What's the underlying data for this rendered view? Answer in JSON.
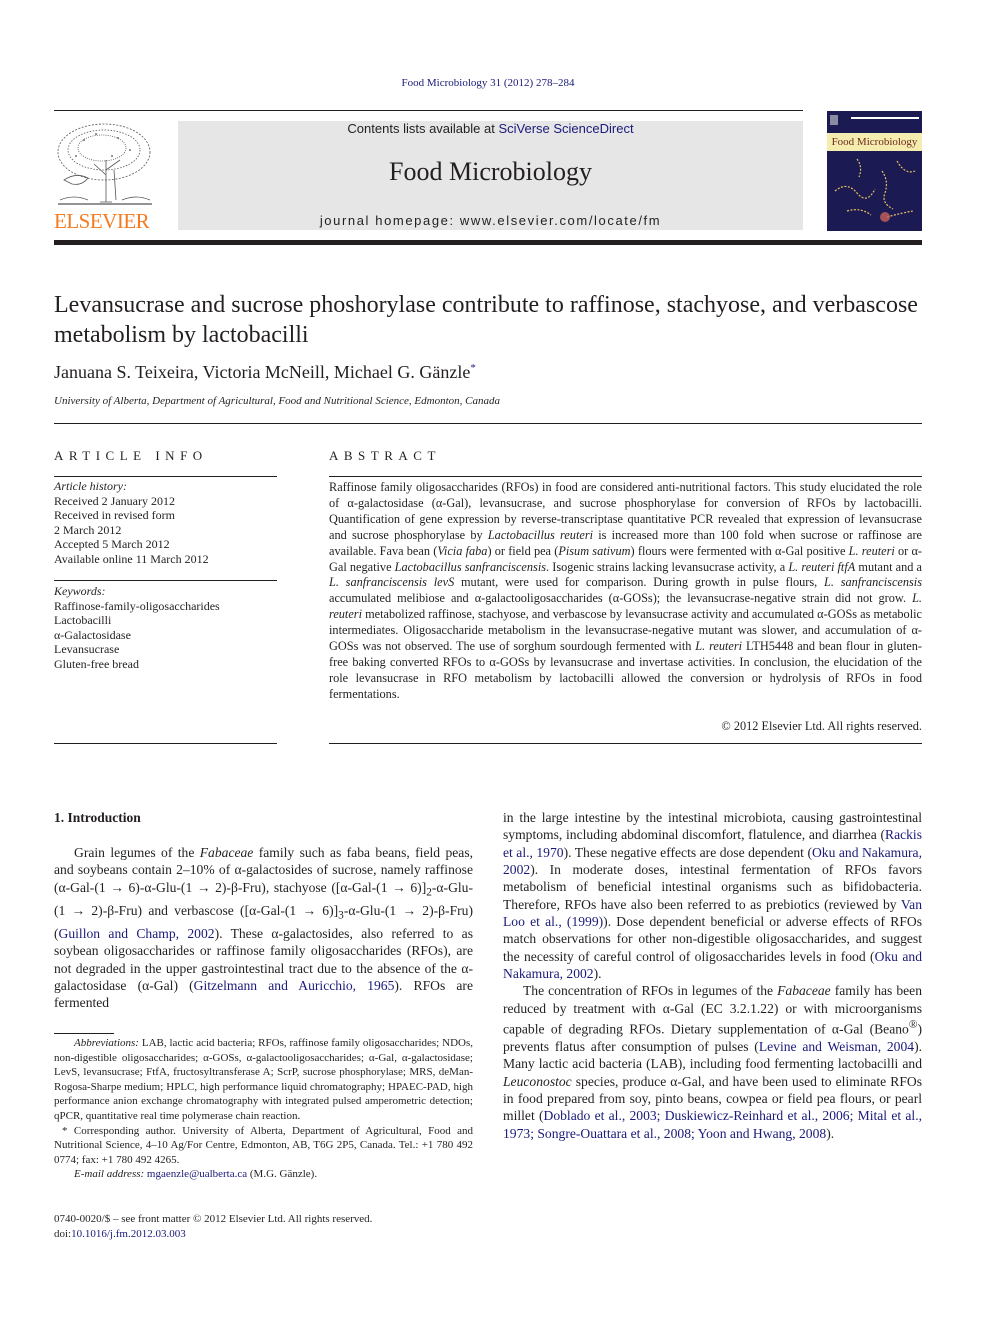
{
  "header": {
    "citation": "Food Microbiology 31 (2012) 278–284",
    "contents_prefix": "Contents lists available at ",
    "contents_link": "SciVerse ScienceDirect",
    "journal_name": "Food Microbiology",
    "homepage": "journal homepage: www.elsevier.com/locate/fm",
    "publisher_logo_text": "ELSEVIER",
    "cover_title": "Food Microbiology",
    "colors": {
      "publisher_orange": "#f47b20",
      "link_blue": "#1a1a7a",
      "box_gray": "#e6e6e6",
      "cover_navy": "#1b1a52"
    }
  },
  "article": {
    "title": "Levansucrase and sucrose phoshorylase contribute to raffinose, stachyose, and verbascose metabolism by lactobacilli",
    "authors": "Januana S. Teixeira, Victoria McNeill, Michael G. Gänzle",
    "author_mark": "*",
    "affiliation": "University of Alberta, Department of Agricultural, Food and Nutritional Science, Edmonton, Canada"
  },
  "article_info": {
    "heading": "ARTICLE INFO",
    "history_label": "Article history:",
    "history": [
      "Received 2 January 2012",
      "Received in revised form",
      "2 March 2012",
      "Accepted 5 March 2012",
      "Available online 11 March 2012"
    ],
    "keywords_label": "Keywords:",
    "keywords": [
      "Raffinose-family-oligosaccharides",
      "Lactobacilli",
      "α-Galactosidase",
      "Levansucrase",
      "Gluten-free bread"
    ]
  },
  "abstract": {
    "heading": "ABSTRACT",
    "segments": [
      {
        "t": "Raffinose family oligosaccharides (RFOs) in food are considered anti-nutritional factors. This study elucidated the role of α-galactosidase (α-Gal), levansucrase, and sucrose phosphorylase for conversion of RFOs by lactobacilli. Quantification of gene expression by reverse-transcriptase quantitative PCR revealed that expression of levansucrase and sucrose phosphorylase by "
      },
      {
        "t": "Lactobacillus reuteri",
        "i": true
      },
      {
        "t": " is increased more than 100 fold when sucrose or raffinose are available. Fava bean ("
      },
      {
        "t": "Vicia faba",
        "i": true
      },
      {
        "t": ") or field pea ("
      },
      {
        "t": "Pisum sativum",
        "i": true
      },
      {
        "t": ") flours were fermented with α-Gal positive "
      },
      {
        "t": "L. reuteri",
        "i": true
      },
      {
        "t": " or α-Gal negative "
      },
      {
        "t": "Lactobacillus sanfranciscensis",
        "i": true
      },
      {
        "t": ". Isogenic strains lacking levansucrase activity, a "
      },
      {
        "t": "L. reuteri ftfA",
        "i": true
      },
      {
        "t": " mutant and a "
      },
      {
        "t": "L. sanfranciscensis levS",
        "i": true
      },
      {
        "t": " mutant, were used for comparison. During growth in pulse flours, "
      },
      {
        "t": "L. sanfranciscensis",
        "i": true
      },
      {
        "t": " accumulated melibiose and α-galactooligosaccharides (α-GOSs); the levansucrase-negative strain did not grow. "
      },
      {
        "t": "L. reuteri",
        "i": true
      },
      {
        "t": " metabolized raffinose, stachyose, and verbascose by levansucrase activity and accumulated α-GOSs as metabolic intermediates. Oligosaccharide metabolism in the levansucrase-negative mutant was slower, and accumulation of α-GOSs was not observed. The use of sorghum sourdough fermented with "
      },
      {
        "t": "L. reuteri",
        "i": true
      },
      {
        "t": " LTH5448 and bean flour in gluten-free baking converted RFOs to α-GOSs by levansucrase and invertase activities. In conclusion, the elucidation of the role levansucrase in RFO metabolism by lactobacilli allowed the conversion or hydrolysis of RFOs in food fermentations."
      }
    ],
    "copyright": "© 2012 Elsevier Ltd. All rights reserved."
  },
  "intro": {
    "heading": "1.  Introduction",
    "left_paragraph": [
      {
        "t": "Grain legumes of the "
      },
      {
        "t": "Fabaceae",
        "i": true
      },
      {
        "t": " family such as faba beans, field peas, and soybeans contain 2–10% of α-galactosides of sucrose, namely raffinose (α-Gal-(1 → 6)-α-Glu-(1 → 2)-β-Fru), stachyose ([α-Gal-(1 → 6)]"
      },
      {
        "t": "2",
        "sub": true
      },
      {
        "t": "-α-Glu-(1 → 2)-β-Fru) and verbascose ([α-Gal-(1 → 6)]"
      },
      {
        "t": "3",
        "sub": true
      },
      {
        "t": "-α-Glu-(1 → 2)-β-Fru) ("
      },
      {
        "t": "Guillon and Champ, 2002",
        "link": true
      },
      {
        "t": "). These α-galactosides, also referred to as soybean oligosaccharides or raffinose family oligosaccharides (RFOs), are not degraded in the upper gastrointestinal tract due to the absence of the α-galactosidase (α-Gal) ("
      },
      {
        "t": "Gitzelmann and Auricchio, 1965",
        "link": true
      },
      {
        "t": "). RFOs are fermented"
      }
    ],
    "right_paragraph_1": [
      {
        "t": "in the large intestine by the intestinal microbiota, causing gastrointestinal symptoms, including abdominal discomfort, flatulence, and diarrhea ("
      },
      {
        "t": "Rackis et al., 1970",
        "link": true
      },
      {
        "t": "). These negative effects are dose dependent ("
      },
      {
        "t": "Oku and Nakamura, 2002",
        "link": true
      },
      {
        "t": "). In moderate doses, intestinal fermentation of RFOs favors metabolism of beneficial intestinal organisms such as bifidobacteria. Therefore, RFOs have also been referred to as prebiotics (reviewed by "
      },
      {
        "t": "Van Loo et al., (1999)",
        "link": true
      },
      {
        "t": "). Dose dependent beneficial or adverse effects of RFOs match observations for other non-digestible oligosaccharides, and suggest the necessity of careful control of oligosaccharides levels in food ("
      },
      {
        "t": "Oku and Nakamura, 2002",
        "link": true
      },
      {
        "t": ")."
      }
    ],
    "right_paragraph_2": [
      {
        "t": "The concentration of RFOs in legumes of the "
      },
      {
        "t": "Fabaceae",
        "i": true
      },
      {
        "t": " family has been reduced by treatment with α-Gal (EC 3.2.1.22) or with microorganisms capable of degrading RFOs. Dietary supplementation of α-Gal (Beano"
      },
      {
        "t": "®",
        "sup": true
      },
      {
        "t": ") prevents flatus after consumption of pulses ("
      },
      {
        "t": "Levine and Weisman, 2004",
        "link": true
      },
      {
        "t": "). Many lactic acid bacteria (LAB), including food fermenting lactobacilli and "
      },
      {
        "t": "Leuconostoc",
        "i": true
      },
      {
        "t": " species, produce α-Gal, and have been used to eliminate RFOs in food prepared from soy, pinto beans, cowpea or field pea flours, or pearl millet ("
      },
      {
        "t": "Doblado et al., 2003; Duskiewicz-Reinhard et al., 2006; Mital et al., 1973; Songre-Ouattara et al., 2008; Yoon and Hwang, 2008",
        "link": true
      },
      {
        "t": ")."
      }
    ]
  },
  "footnotes": {
    "abbreviations": [
      {
        "t": "Abbreviations:",
        "i": true
      },
      {
        "t": " LAB, lactic acid bacteria; RFOs, raffinose family oligosaccharides; NDOs, non-digestible oligosaccharides; α-GOSs, α-galactooligosaccharides; α-Gal, α-galactosidase; LevS, levansucrase; FtfA, fructosyltransferase A; ScrP, sucrose phosphorylase; MRS, deMan-Rogosa-Sharpe medium; HPLC, high performance liquid chromatography; HPAEC-PAD, high performance anion exchange chromatography with integrated pulsed amperometric detection; qPCR, quantitative real time polymerase chain reaction."
      }
    ],
    "corresponding": "* Corresponding author. University of Alberta, Department of Agricultural, Food and Nutritional Science, 4–10 Ag/For Centre, Edmonton, AB, T6G 2P5, Canada. Tel.: +1 780 492 0774; fax: +1 780 492 4265.",
    "email_label": "E-mail address:",
    "email": "mgaenzle@ualberta.ca",
    "email_suffix": " (M.G. Gänzle)."
  },
  "front_matter": {
    "issn_line": "0740-0020/$ – see front matter © 2012 Elsevier Ltd. All rights reserved.",
    "doi_prefix": "doi:",
    "doi": "10.1016/j.fm.2012.03.003"
  }
}
